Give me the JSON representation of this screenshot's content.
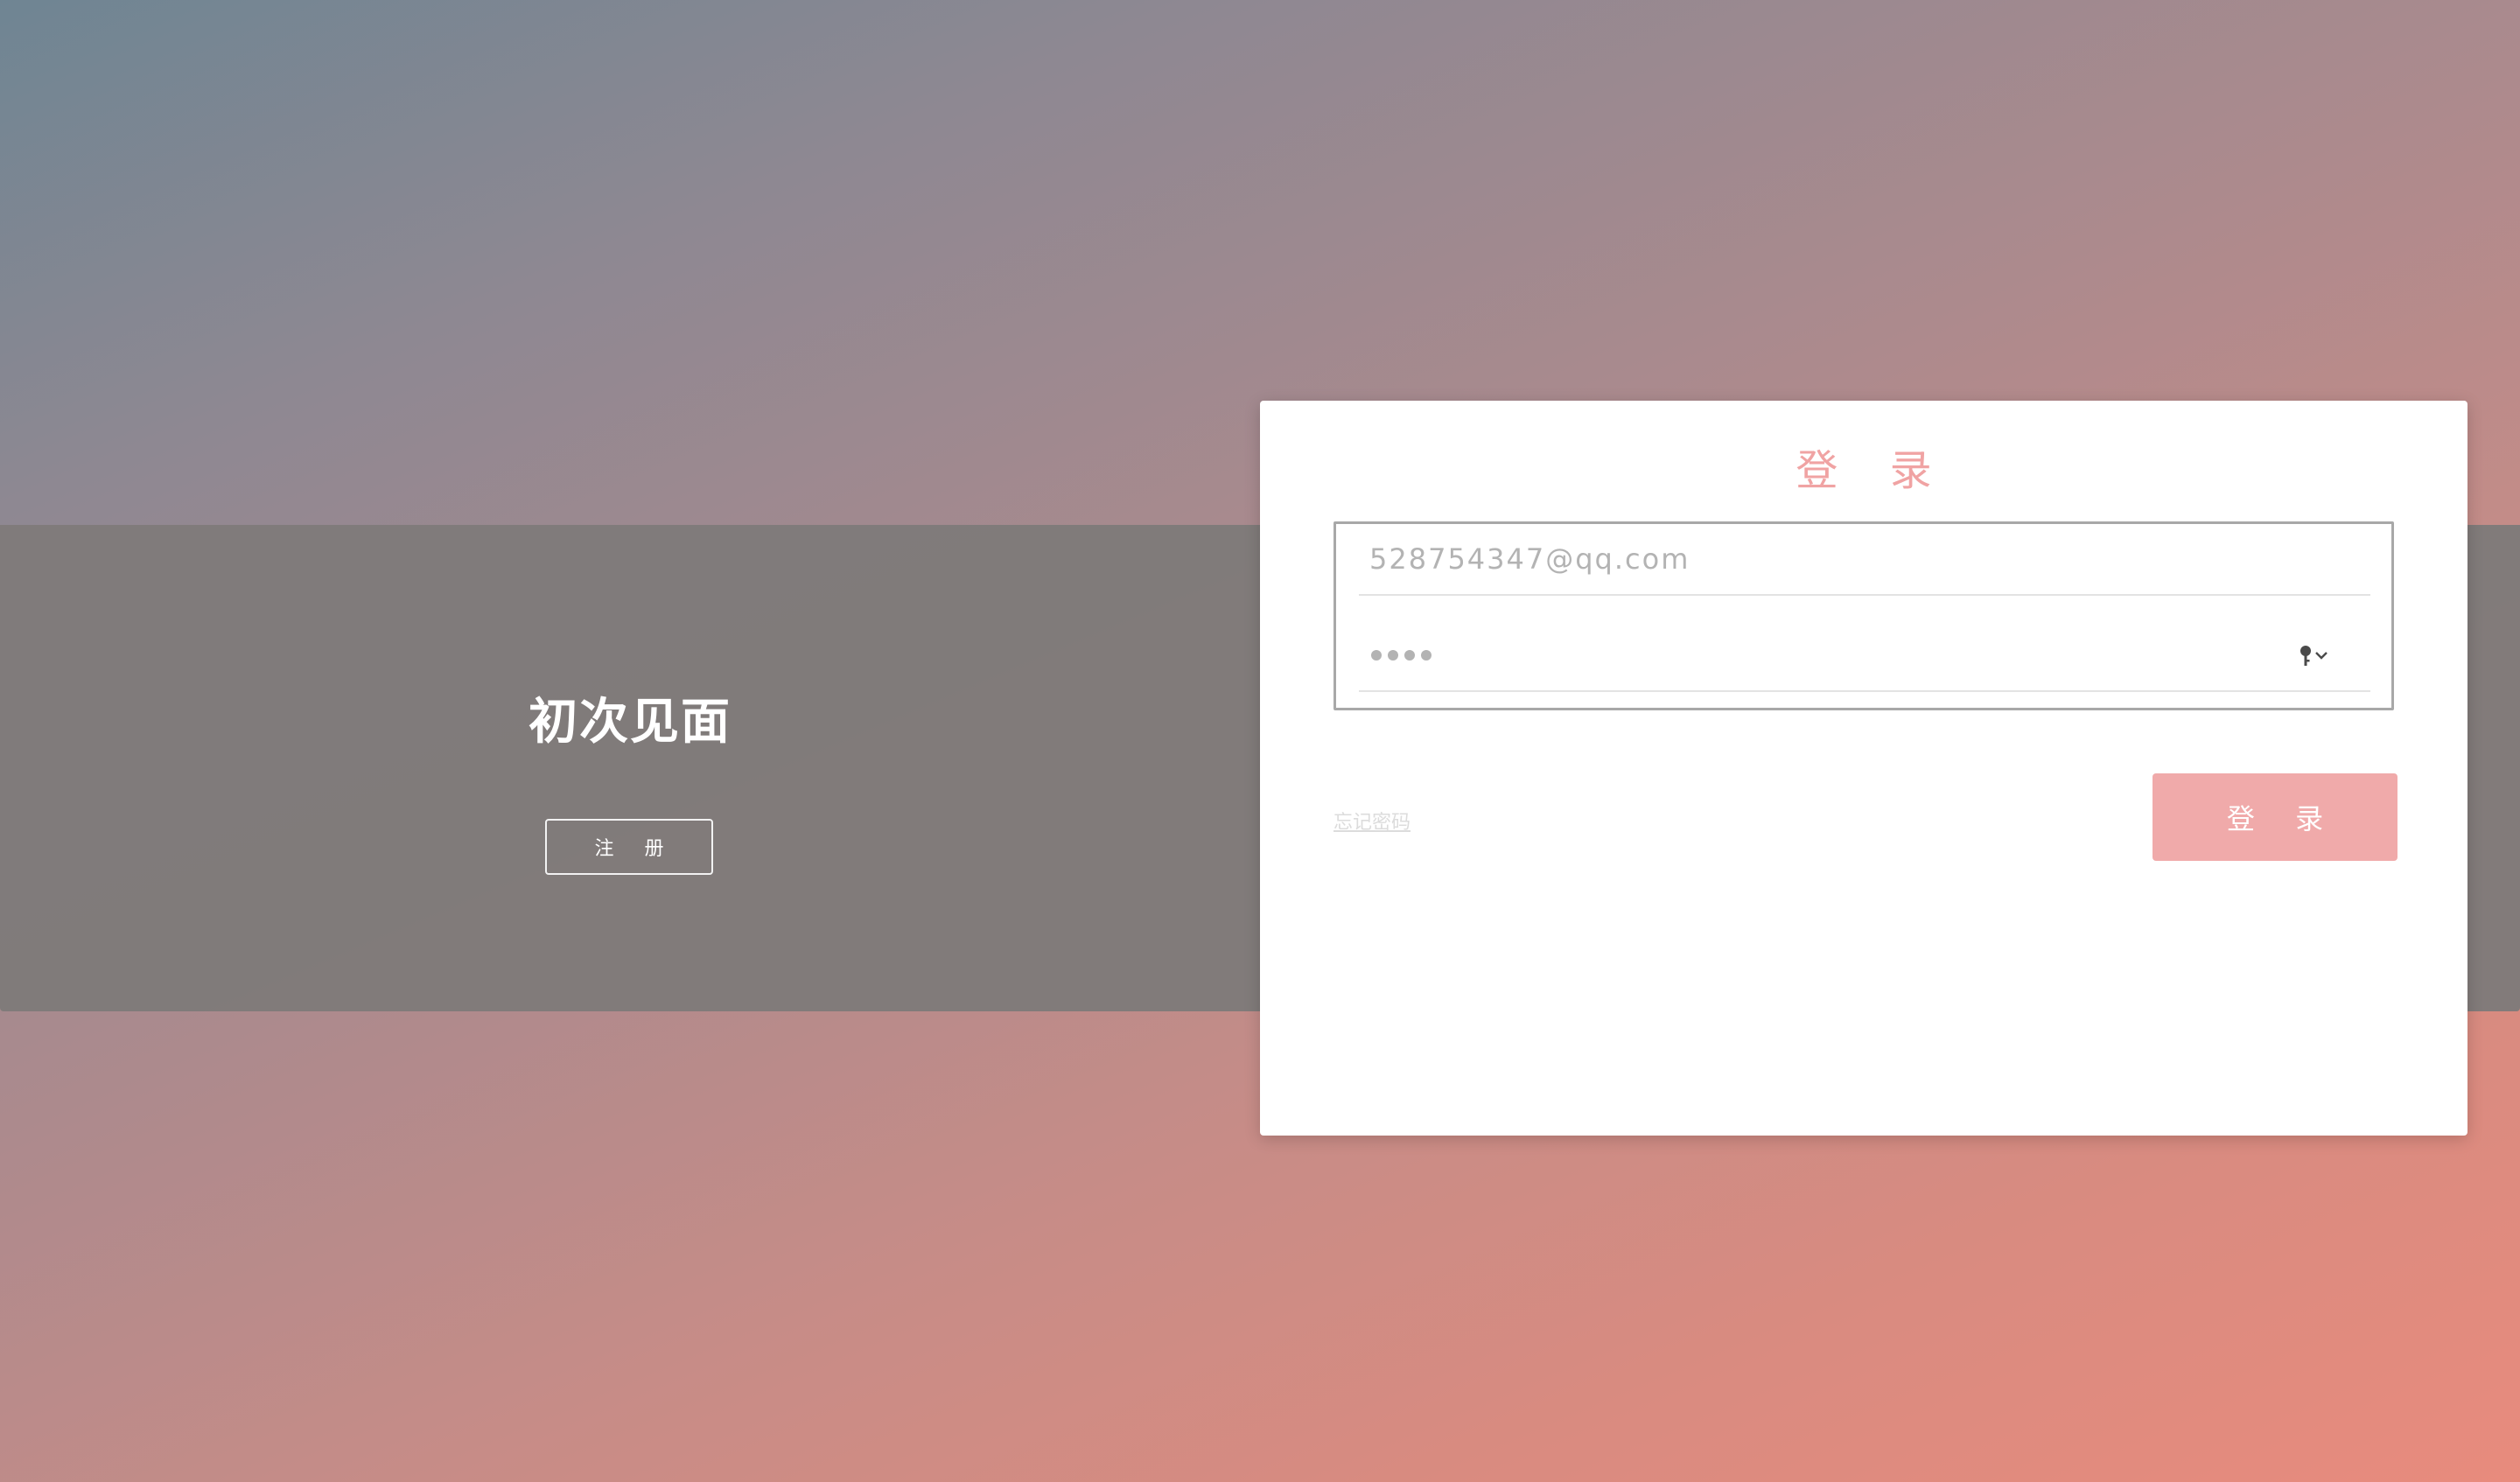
{
  "welcome_panel": {
    "heading": "初次见面",
    "register_label": "注 册"
  },
  "login_card": {
    "title": "登 录",
    "email_value": "528754347@qq.com",
    "password_dots": 4,
    "forgot_password_label": "忘记密码",
    "submit_label": "登 录"
  },
  "icons": {
    "password_field_icon": "key-with-chevron-down-icon"
  },
  "colors": {
    "accent": "#f0aaaa",
    "title_accent": "#f0a3a3",
    "band": "#7f7b7a"
  }
}
